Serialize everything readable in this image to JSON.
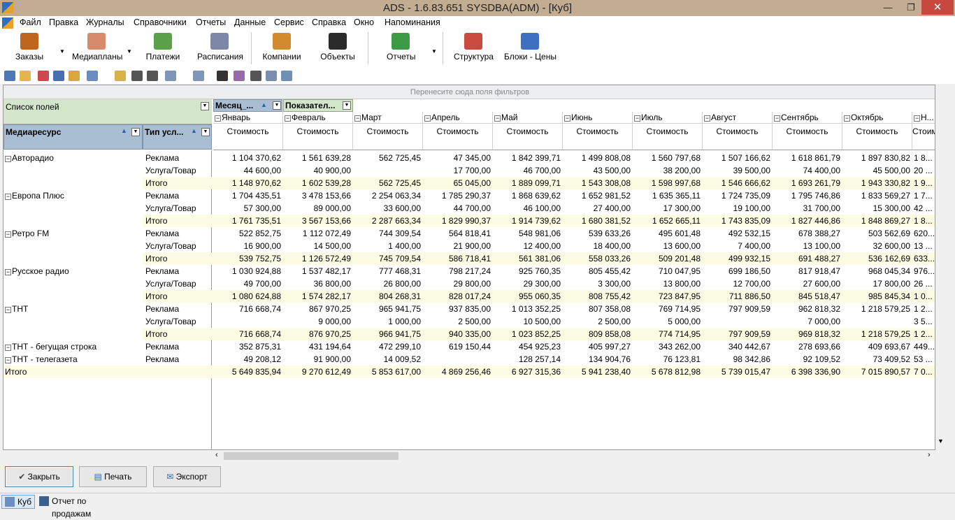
{
  "window": {
    "title": "ADS - 1.6.83.651 SYSDBA(ADM) - [Куб]",
    "close_symbol": "✕",
    "min_symbol": "—",
    "max_symbol": "❐"
  },
  "menu": [
    "Файл",
    "Правка",
    "Журналы",
    "Справочники",
    "Отчеты",
    "Данные",
    "Сервис",
    "Справка",
    "Окно",
    "Напоминания"
  ],
  "toolbar": [
    "Заказы",
    "Медиапланы",
    "Платежи",
    "Расписания",
    "Компании",
    "Объекты",
    "Отчеты",
    "Структура",
    "Блоки - Цены"
  ],
  "pivot": {
    "filter_hint": "Перенесите сюда поля фильтров",
    "field_list": "Список полей",
    "column_fields": [
      "Месяц_...",
      "Показател..."
    ],
    "row_fields": [
      "Медиаресурс",
      "Тип усл..."
    ],
    "measure": "Стоимость",
    "months": [
      "Январь",
      "Февраль",
      "Март",
      "Апрель",
      "Май",
      "Июнь",
      "Июль",
      "Август",
      "Сентябрь",
      "Октябрь",
      "Н..."
    ],
    "rows": [
      {
        "res": "Авторадио",
        "type": "Реклама",
        "vals": [
          "1 104 370,62",
          "1 561 639,28",
          "562 725,45",
          "47 345,00",
          "1 842 399,71",
          "1 499 808,08",
          "1 560 797,68",
          "1 507 166,62",
          "1 618 861,79",
          "1 897 830,82",
          "1 8..."
        ]
      },
      {
        "res": "",
        "type": "Услуга/Товар",
        "vals": [
          "44 600,00",
          "40 900,00",
          "",
          "17 700,00",
          "46 700,00",
          "43 500,00",
          "38 200,00",
          "39 500,00",
          "74 400,00",
          "45 500,00",
          "20 ..."
        ]
      },
      {
        "res": "",
        "type": "Итого",
        "vals": [
          "1 148 970,62",
          "1 602 539,28",
          "562 725,45",
          "65 045,00",
          "1 889 099,71",
          "1 543 308,08",
          "1 598 997,68",
          "1 546 666,62",
          "1 693 261,79",
          "1 943 330,82",
          "1 9..."
        ],
        "total": true
      },
      {
        "res": "Европа Плюс",
        "type": "Реклама",
        "vals": [
          "1 704 435,51",
          "3 478 153,66",
          "2 254 063,34",
          "1 785 290,37",
          "1 868 639,62",
          "1 652 981,52",
          "1 635 365,11",
          "1 724 735,09",
          "1 795 746,86",
          "1 833 569,27",
          "1 7..."
        ]
      },
      {
        "res": "",
        "type": "Услуга/Товар",
        "vals": [
          "57 300,00",
          "89 000,00",
          "33 600,00",
          "44 700,00",
          "46 100,00",
          "27 400,00",
          "17 300,00",
          "19 100,00",
          "31 700,00",
          "15 300,00",
          "42 ..."
        ]
      },
      {
        "res": "",
        "type": "Итого",
        "vals": [
          "1 761 735,51",
          "3 567 153,66",
          "2 287 663,34",
          "1 829 990,37",
          "1 914 739,62",
          "1 680 381,52",
          "1 652 665,11",
          "1 743 835,09",
          "1 827 446,86",
          "1 848 869,27",
          "1 8..."
        ],
        "total": true
      },
      {
        "res": "Ретро FM",
        "type": "Реклама",
        "vals": [
          "522 852,75",
          "1 112 072,49",
          "744 309,54",
          "564 818,41",
          "548 981,06",
          "539 633,26",
          "495 601,48",
          "492 532,15",
          "678 388,27",
          "503 562,69",
          "620..."
        ]
      },
      {
        "res": "",
        "type": "Услуга/Товар",
        "vals": [
          "16 900,00",
          "14 500,00",
          "1 400,00",
          "21 900,00",
          "12 400,00",
          "18 400,00",
          "13 600,00",
          "7 400,00",
          "13 100,00",
          "32 600,00",
          "13 ..."
        ]
      },
      {
        "res": "",
        "type": "Итого",
        "vals": [
          "539 752,75",
          "1 126 572,49",
          "745 709,54",
          "586 718,41",
          "561 381,06",
          "558 033,26",
          "509 201,48",
          "499 932,15",
          "691 488,27",
          "536 162,69",
          "633..."
        ],
        "total": true
      },
      {
        "res": "Русское радио",
        "type": "Реклама",
        "vals": [
          "1 030 924,88",
          "1 537 482,17",
          "777 468,31",
          "798 217,24",
          "925 760,35",
          "805 455,42",
          "710 047,95",
          "699 186,50",
          "817 918,47",
          "968 045,34",
          "976..."
        ]
      },
      {
        "res": "",
        "type": "Услуга/Товар",
        "vals": [
          "49 700,00",
          "36 800,00",
          "26 800,00",
          "29 800,00",
          "29 300,00",
          "3 300,00",
          "13 800,00",
          "12 700,00",
          "27 600,00",
          "17 800,00",
          "26 ..."
        ]
      },
      {
        "res": "",
        "type": "Итого",
        "vals": [
          "1 080 624,88",
          "1 574 282,17",
          "804 268,31",
          "828 017,24",
          "955 060,35",
          "808 755,42",
          "723 847,95",
          "711 886,50",
          "845 518,47",
          "985 845,34",
          "1 0..."
        ],
        "total": true
      },
      {
        "res": "ТНТ",
        "type": "Реклама",
        "vals": [
          "716 668,74",
          "867 970,25",
          "965 941,75",
          "937 835,00",
          "1 013 352,25",
          "807 358,08",
          "769 714,95",
          "797 909,59",
          "962 818,32",
          "1 218 579,25",
          "1 2..."
        ]
      },
      {
        "res": "",
        "type": "Услуга/Товар",
        "vals": [
          "",
          "9 000,00",
          "1 000,00",
          "2 500,00",
          "10 500,00",
          "2 500,00",
          "5 000,00",
          "",
          "7 000,00",
          "",
          "3 5..."
        ]
      },
      {
        "res": "",
        "type": "Итого",
        "vals": [
          "716 668,74",
          "876 970,25",
          "966 941,75",
          "940 335,00",
          "1 023 852,25",
          "809 858,08",
          "774 714,95",
          "797 909,59",
          "969 818,32",
          "1 218 579,25",
          "1 2..."
        ],
        "total": true
      },
      {
        "res": "ТНТ - бегущая строка",
        "type": "Реклама",
        "vals": [
          "352 875,31",
          "431 194,64",
          "472 299,10",
          "619 150,44",
          "454 925,23",
          "405 997,27",
          "343 262,00",
          "340 442,67",
          "278 693,66",
          "409 693,67",
          "449..."
        ]
      },
      {
        "res": "ТНТ - телегазета",
        "type": "Реклама",
        "vals": [
          "49 208,12",
          "91 900,00",
          "14 009,52",
          "",
          "128 257,14",
          "134 904,76",
          "76 123,81",
          "98 342,86",
          "92 109,52",
          "73 409,52",
          "53 ..."
        ]
      },
      {
        "res": "Итого",
        "type": "",
        "vals": [
          "5 649 835,94",
          "9 270 612,49",
          "5 853 617,00",
          "4 869 256,46",
          "6 927 315,36",
          "5 941 238,40",
          "5 678 812,98",
          "5 739 015,47",
          "6 398 336,90",
          "7 015 890,57",
          "7 0..."
        ],
        "total": true,
        "grand": true
      }
    ]
  },
  "buttons": {
    "close": "Закрыть",
    "print": "Печать",
    "export": "Экспорт"
  },
  "tabs": [
    "Куб",
    "Отчет по продажам"
  ],
  "colors": {
    "titlebar": "#c3ad92",
    "fieldlist": "#d3e6cc",
    "header": "#a9bdd3",
    "total": "#fcfbe3"
  }
}
